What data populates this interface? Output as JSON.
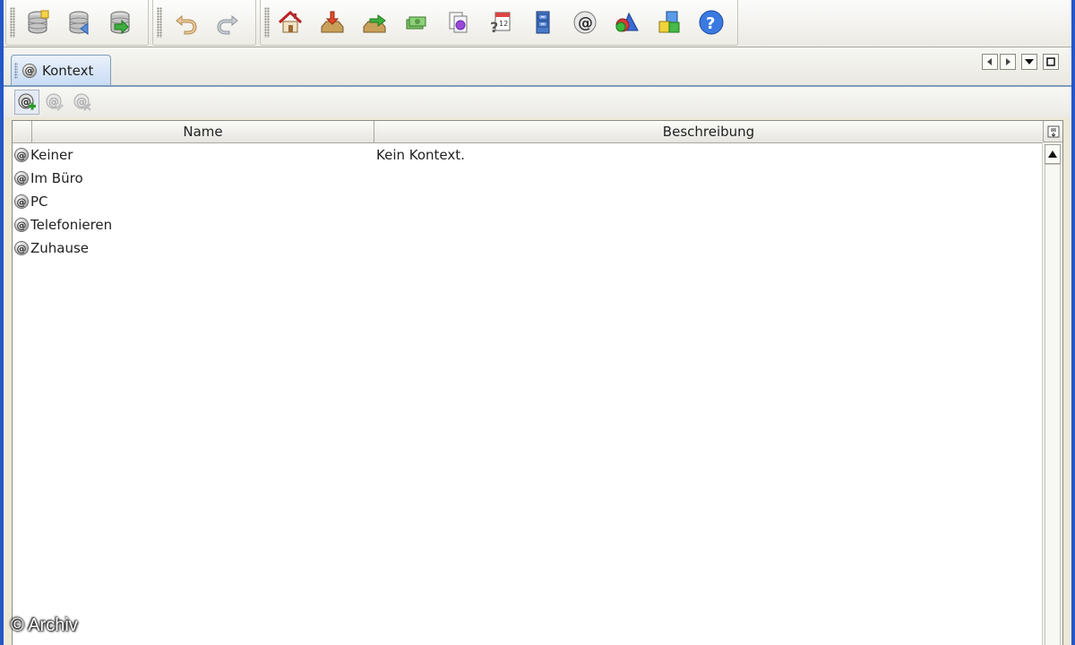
{
  "toolbar": {
    "buttons": [
      {
        "icon": "database-new-icon"
      },
      {
        "icon": "database-open-icon"
      },
      {
        "icon": "database-save-icon"
      },
      {
        "icon": "undo-icon"
      },
      {
        "icon": "redo-icon"
      },
      {
        "icon": "home-icon"
      },
      {
        "icon": "inbox-import-icon"
      },
      {
        "icon": "outbox-export-icon"
      },
      {
        "icon": "money-icon"
      },
      {
        "icon": "documents-icon"
      },
      {
        "icon": "calendar-help-icon"
      },
      {
        "icon": "filing-cabinet-icon"
      },
      {
        "icon": "at-context-icon"
      },
      {
        "icon": "shapes-icon"
      },
      {
        "icon": "cubes-icon"
      },
      {
        "icon": "help-icon"
      }
    ]
  },
  "tab": {
    "label": "Kontext"
  },
  "table": {
    "columns": {
      "name": "Name",
      "description": "Beschreibung"
    },
    "rows": [
      {
        "name": "Keiner",
        "description": "Kein Kontext."
      },
      {
        "name": "Im Büro",
        "description": ""
      },
      {
        "name": "PC",
        "description": ""
      },
      {
        "name": "Telefonieren",
        "description": ""
      },
      {
        "name": "Zuhause",
        "description": ""
      }
    ]
  },
  "watermark": "© Archiv"
}
